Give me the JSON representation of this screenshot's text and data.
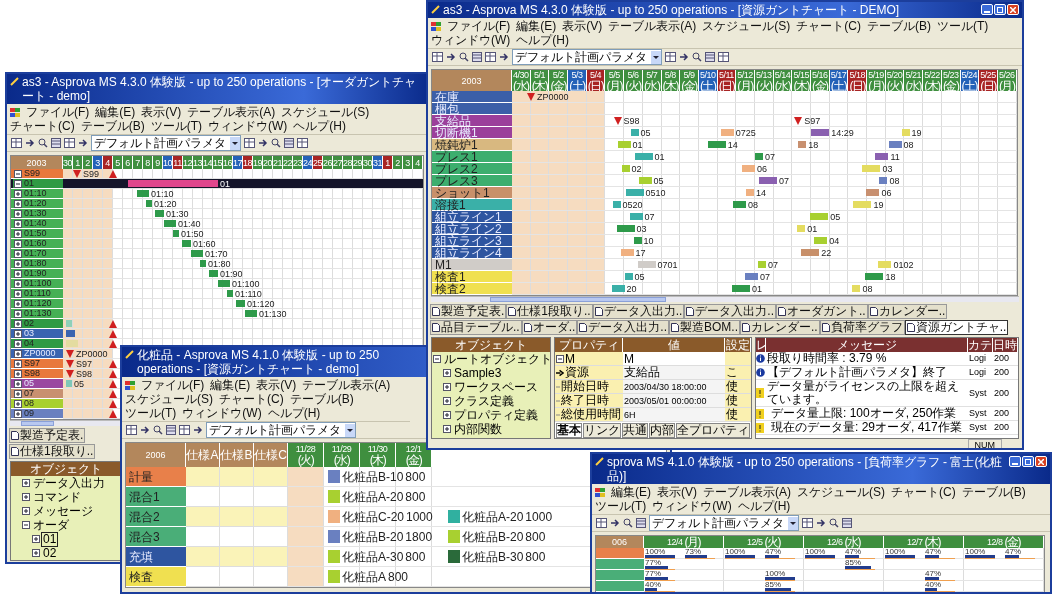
{
  "windows": [
    {
      "kind": "order_gantt",
      "title": "as3 - Asprova MS 4.3.0 体験版 - up to 250 operations - [オーダガントチャート - demo]",
      "menu": [
        "ファイル(F)",
        "編集(E)",
        "表示(V)",
        "テーブル表示(A)",
        "スケジュール(S)",
        "チャート(C)",
        "テーブル(B)",
        "ツール(T)",
        "ウィンドウ(W)",
        "ヘルプ(H)"
      ],
      "combo": "デフォルト計画パラメタ",
      "year": "2003",
      "dates": [
        {
          "date": "30",
          "kind": "weekday",
          "past": true
        },
        {
          "date": "1",
          "kind": "weekday",
          "past": true
        },
        {
          "date": "2",
          "kind": "weekday",
          "past": true
        },
        {
          "date": "3",
          "kind": "saturday",
          "past": true
        },
        {
          "date": "4",
          "kind": "sunday",
          "past": true
        },
        {
          "date": "5",
          "kind": "weekday",
          "past": false
        },
        {
          "date": "6",
          "kind": "weekday",
          "past": false
        },
        {
          "date": "7",
          "kind": "weekday",
          "past": false
        },
        {
          "date": "8",
          "kind": "weekday",
          "past": false
        },
        {
          "date": "9",
          "kind": "weekday",
          "past": false
        },
        {
          "date": "10",
          "kind": "saturday",
          "past": false
        },
        {
          "date": "11",
          "kind": "sunday",
          "past": false
        },
        {
          "date": "12",
          "kind": "weekday",
          "past": false
        },
        {
          "date": "13",
          "kind": "weekday",
          "past": false
        },
        {
          "date": "14",
          "kind": "weekday",
          "past": false
        },
        {
          "date": "15",
          "kind": "weekday",
          "past": false
        },
        {
          "date": "16",
          "kind": "weekday",
          "past": false
        },
        {
          "date": "17",
          "kind": "saturday",
          "past": false
        },
        {
          "date": "18",
          "kind": "sunday",
          "past": false
        },
        {
          "date": "19",
          "kind": "weekday",
          "past": false
        },
        {
          "date": "20",
          "kind": "weekday",
          "past": false
        },
        {
          "date": "21",
          "kind": "weekday",
          "past": false
        },
        {
          "date": "22",
          "kind": "weekday",
          "past": false
        },
        {
          "date": "23",
          "kind": "weekday",
          "past": false
        },
        {
          "date": "24",
          "kind": "saturday",
          "past": false
        },
        {
          "date": "25",
          "kind": "sunday",
          "past": false
        },
        {
          "date": "26",
          "kind": "weekday",
          "past": false
        },
        {
          "date": "27",
          "kind": "weekday",
          "past": false
        },
        {
          "date": "28",
          "kind": "weekday",
          "past": false
        },
        {
          "date": "29",
          "kind": "weekday",
          "past": false
        },
        {
          "date": "30",
          "kind": "weekday",
          "past": false
        },
        {
          "date": "31",
          "kind": "saturday",
          "past": false
        },
        {
          "date": "1",
          "kind": "sunday",
          "past": false
        },
        {
          "date": "2",
          "kind": "weekday",
          "past": false
        },
        {
          "date": "3",
          "kind": "weekday",
          "past": false
        },
        {
          "date": "4",
          "kind": "weekday",
          "past": false
        }
      ],
      "rows": [
        {
          "label": "S99",
          "color": "#e8783c",
          "expanded": true,
          "selected": false,
          "bars": [
            {
              "kind": "marker",
              "label": "S99"
            },
            {
              "kind": "due"
            }
          ]
        },
        {
          "label": "01",
          "color": "#2f9a44",
          "expanded": true,
          "selected": true,
          "bars": [
            {
              "kind": "bar",
              "label": "01",
              "color": "#e0468c"
            }
          ]
        },
        {
          "label": "01:10",
          "color": "#45b055",
          "expanded": false,
          "selected": false,
          "bars": [
            {
              "kind": "bar",
              "label": "01:10",
              "color": "#2e9a4a"
            }
          ]
        },
        {
          "label": "01:20",
          "color": "#45b055",
          "expanded": false,
          "selected": false,
          "bars": [
            {
              "kind": "bar",
              "label": "01:20",
              "color": "#2e9a4a"
            }
          ]
        },
        {
          "label": "01:30",
          "color": "#45b055",
          "expanded": false,
          "selected": false,
          "bars": [
            {
              "kind": "bar",
              "label": "01:30",
              "color": "#2e9a4a"
            }
          ]
        },
        {
          "label": "01:40",
          "color": "#45b055",
          "expanded": false,
          "selected": false,
          "bars": [
            {
              "kind": "bar",
              "label": "01:40",
              "color": "#2e9a4a"
            }
          ]
        },
        {
          "label": "01:50",
          "color": "#45b055",
          "expanded": false,
          "selected": false,
          "bars": [
            {
              "kind": "bar",
              "label": "01:50",
              "color": "#2e9a4a"
            }
          ]
        },
        {
          "label": "01:60",
          "color": "#45b055",
          "expanded": false,
          "selected": false,
          "bars": [
            {
              "kind": "bar",
              "label": "01:60",
              "color": "#2e9a4a"
            }
          ]
        },
        {
          "label": "01:70",
          "color": "#45b055",
          "expanded": false,
          "selected": false,
          "bars": [
            {
              "kind": "bar",
              "label": "01:70",
              "color": "#2e9a4a"
            }
          ]
        },
        {
          "label": "01:80",
          "color": "#45b055",
          "expanded": false,
          "selected": false,
          "bars": [
            {
              "kind": "bar",
              "label": "01:80",
              "color": "#2e9a4a"
            }
          ]
        },
        {
          "label": "01:90",
          "color": "#45b055",
          "expanded": false,
          "selected": false,
          "bars": [
            {
              "kind": "bar",
              "label": "01:90",
              "color": "#2e9a4a"
            }
          ]
        },
        {
          "label": "01:100",
          "color": "#45b055",
          "expanded": false,
          "selected": false,
          "bars": [
            {
              "kind": "bar",
              "label": "01:100",
              "color": "#2e9a4a"
            }
          ]
        },
        {
          "label": "01:110",
          "color": "#45b055",
          "expanded": false,
          "selected": false,
          "bars": [
            {
              "kind": "bar",
              "label": "01:110",
              "color": "#2e9a4a"
            }
          ]
        },
        {
          "label": "01:120",
          "color": "#45b055",
          "expanded": false,
          "selected": false,
          "bars": [
            {
              "kind": "bar",
              "label": "01:120",
              "color": "#2e9a4a"
            }
          ]
        },
        {
          "label": "01:130",
          "color": "#45b055",
          "expanded": false,
          "selected": false,
          "bars": [
            {
              "kind": "bar",
              "label": "01:130",
              "color": "#2e9a4a"
            }
          ]
        },
        {
          "label": "02",
          "color": "#2f9a44",
          "expanded": false,
          "selected": false,
          "bars": [
            {
              "kind": "due"
            },
            {
              "kind": "bar",
              "color": "#8fd0b8"
            }
          ]
        },
        {
          "label": "03",
          "color": "#3a64b0",
          "expanded": false,
          "selected": false,
          "bars": [
            {
              "kind": "due"
            },
            {
              "kind": "bar",
              "color": "#3a64b0"
            }
          ]
        },
        {
          "label": "04",
          "color": "#2f9a44",
          "expanded": false,
          "selected": false,
          "bars": [
            {
              "kind": "due"
            },
            {
              "kind": "bar",
              "color": "#e4dca0"
            }
          ]
        },
        {
          "label": "ZP0000",
          "color": "#3a64b0",
          "expanded": false,
          "selected": false,
          "bars": [
            {
              "kind": "marker",
              "label": "ZP0000"
            }
          ]
        },
        {
          "label": "S97",
          "color": "#e8783c",
          "expanded": false,
          "selected": false,
          "bars": [
            {
              "kind": "due"
            },
            {
              "kind": "marker",
              "label": "S97"
            }
          ]
        },
        {
          "label": "S98",
          "color": "#e8783c",
          "expanded": false,
          "selected": false,
          "bars": [
            {
              "kind": "due"
            },
            {
              "kind": "marker",
              "label": "S98"
            }
          ]
        },
        {
          "label": "05",
          "color": "#9a48a0",
          "expanded": false,
          "selected": false,
          "bars": [
            {
              "kind": "due"
            },
            {
              "kind": "bar",
              "label": "05",
              "color": "#7fc8b8"
            }
          ]
        },
        {
          "label": "07",
          "color": "#c89070",
          "expanded": false,
          "selected": false,
          "bars": [
            {
              "kind": "due"
            }
          ]
        },
        {
          "label": "08",
          "color": "#a8d030",
          "expanded": false,
          "selected": false,
          "bars": [
            {
              "kind": "due"
            }
          ]
        },
        {
          "label": "09",
          "color": "#6a80c0",
          "expanded": false,
          "selected": false,
          "bars": [
            {
              "kind": "due"
            }
          ]
        }
      ],
      "tabs": [
        {
          "label": "製造予定表.",
          "selected": false
        },
        {
          "label": "仕様1段取り..",
          "selected": false
        }
      ],
      "tree": {
        "title": "オブジェクト",
        "items": [
          {
            "label": "データ入出力",
            "expanded": false,
            "selected": false
          },
          {
            "label": "コマンド",
            "expanded": false,
            "selected": false
          },
          {
            "label": "メッセージ",
            "expanded": false,
            "selected": false
          },
          {
            "label": "オーダ",
            "expanded": true,
            "selected": false,
            "children": [
              {
                "label": "01",
                "expanded": false,
                "selected": true
              },
              {
                "label": "02",
                "expanded": false,
                "selected": false
              }
            ]
          }
        ]
      }
    },
    {
      "kind": "resource_gantt",
      "title": "化粧品 - Asprova MS 4.1.0 体験版 - up to 250 operations - [資源ガントチャート - demo]",
      "menu": [
        "ファイル(F)",
        "編集(E)",
        "表示(V)",
        "テーブル表示(A)",
        "スケジュール(S)",
        "チャート(C)",
        "テーブル(B)",
        "ツール(T)",
        "ウィンドウ(W)",
        "ヘルプ(H)"
      ],
      "combo": "デフォルト計画パラメタ",
      "year": "2006",
      "specs": [
        "仕様A",
        "仕様B",
        "仕様C"
      ],
      "dates": [
        {
          "date": "11/28",
          "weekday": "(火)",
          "kind": "weekday",
          "past": true
        },
        {
          "date": "11/29",
          "weekday": "(水)",
          "kind": "weekday",
          "past": false
        },
        {
          "date": "11/30",
          "weekday": "(木)",
          "kind": "weekday",
          "past": false
        },
        {
          "date": "12/1",
          "weekday": "(金)",
          "kind": "weekday",
          "past": false
        }
      ],
      "rows": [
        {
          "label": "計量",
          "color": "#e8804a",
          "bars": [
            {
              "kind": "bar",
              "label": "化粧品B-10",
              "qty": "800",
              "color": "#6a80c0"
            }
          ]
        },
        {
          "label": "混合1",
          "color": "#4aae78",
          "bars": [
            {
              "kind": "bar",
              "label": "化粧品A-20",
              "qty": "800",
              "color": "#a8d030"
            }
          ]
        },
        {
          "label": "混合2",
          "color": "#4aae78",
          "bars": [
            {
              "kind": "bar",
              "label": "化粧品C-20",
              "qty": "1000",
              "color": "#f0b080"
            },
            {
              "kind": "bar",
              "label": "化粧品A-20",
              "qty": "1000",
              "color": "#30b0a0"
            }
          ]
        },
        {
          "label": "混合3",
          "color": "#4aae78",
          "bars": [
            {
              "kind": "bar",
              "label": "化粧品B-20",
              "qty": "1800",
              "color": "#6a80c0"
            },
            {
              "kind": "bar",
              "label": "化粧品B-20",
              "qty": "800",
              "color": "#a8d030"
            }
          ]
        },
        {
          "label": "充填",
          "color": "#2e55a0",
          "bars": [
            {
              "kind": "bar",
              "label": "化粧品A-30",
              "qty": "800",
              "color": "#a8d030"
            },
            {
              "kind": "bar",
              "label": "化粧品B-30",
              "qty": "800",
              "color": "#2a6a3a"
            }
          ]
        },
        {
          "label": "検査",
          "color": "#f0e050",
          "bars": [
            {
              "kind": "bar",
              "label": "化粧品A",
              "qty": "800",
              "color": "#a8d030"
            }
          ]
        }
      ]
    },
    {
      "kind": "resource_gantt",
      "title": "as3 - Asprova MS 4.3.0 体験版 - up to 250 operations - [資源ガントチャート - DEMO]",
      "controls": true,
      "menu": [
        "ファイル(F)",
        "編集(E)",
        "表示(V)",
        "テーブル表示(A)",
        "スケジュール(S)",
        "チャート(C)",
        "テーブル(B)",
        "ツール(T)",
        "ウィンドウ(W)",
        "ヘルプ(H)"
      ],
      "combo": "デフォルト計画パラメタ",
      "year": "2003",
      "dates": [
        {
          "date": "4/30",
          "weekday": "(水)",
          "kind": "weekday",
          "past": true
        },
        {
          "date": "5/1",
          "weekday": "(木)",
          "kind": "weekday",
          "past": true
        },
        {
          "date": "5/2",
          "weekday": "(金)",
          "kind": "weekday",
          "past": true
        },
        {
          "date": "5/3",
          "weekday": "(土)",
          "kind": "saturday",
          "past": true
        },
        {
          "date": "5/4",
          "weekday": "(日)",
          "kind": "sunday",
          "past": true
        },
        {
          "date": "5/5",
          "weekday": "(月)",
          "kind": "weekday",
          "past": false
        },
        {
          "date": "5/6",
          "weekday": "(火)",
          "kind": "weekday",
          "past": false
        },
        {
          "date": "5/7",
          "weekday": "(水)",
          "kind": "weekday",
          "past": false
        },
        {
          "date": "5/8",
          "weekday": "(木)",
          "kind": "weekday",
          "past": false
        },
        {
          "date": "5/9",
          "weekday": "(金)",
          "kind": "weekday",
          "past": false
        },
        {
          "date": "5/10",
          "weekday": "(土)",
          "kind": "saturday",
          "past": false
        },
        {
          "date": "5/11",
          "weekday": "(日)",
          "kind": "sunday",
          "past": false
        },
        {
          "date": "5/12",
          "weekday": "(月)",
          "kind": "weekday",
          "past": false
        },
        {
          "date": "5/13",
          "weekday": "(火)",
          "kind": "weekday",
          "past": false
        },
        {
          "date": "5/14",
          "weekday": "(水)",
          "kind": "weekday",
          "past": false
        },
        {
          "date": "5/15",
          "weekday": "(木)",
          "kind": "weekday",
          "past": false
        },
        {
          "date": "5/16",
          "weekday": "(金)",
          "kind": "weekday",
          "past": false
        },
        {
          "date": "5/17",
          "weekday": "(土)",
          "kind": "saturday",
          "past": false
        },
        {
          "date": "5/18",
          "weekday": "(日)",
          "kind": "sunday",
          "past": false
        },
        {
          "date": "5/19",
          "weekday": "(月)",
          "kind": "weekday",
          "past": false
        },
        {
          "date": "5/20",
          "weekday": "(火)",
          "kind": "weekday",
          "past": false
        },
        {
          "date": "5/21",
          "weekday": "(水)",
          "kind": "weekday",
          "past": false
        },
        {
          "date": "5/22",
          "weekday": "(木)",
          "kind": "weekday",
          "past": false
        },
        {
          "date": "5/23",
          "weekday": "(金)",
          "kind": "weekday",
          "past": false
        },
        {
          "date": "5/24",
          "weekday": "(土)",
          "kind": "saturday",
          "past": false
        },
        {
          "date": "5/25",
          "weekday": "(日)",
          "kind": "sunday",
          "past": false
        },
        {
          "date": "5/26",
          "weekday": "(月)",
          "kind": "weekday",
          "past": false
        }
      ],
      "rows": [
        {
          "label": "在庫",
          "color": "#3b5fa8",
          "bars": [
            {
              "kind": "marker",
              "label": "ZP0000"
            }
          ]
        },
        {
          "label": "梱包",
          "color": "#3b5fa8",
          "bars": []
        },
        {
          "label": "支給品",
          "color": "#9b3f9b",
          "bars": [
            {
              "kind": "marker",
              "label": "S98"
            },
            {
              "kind": "marker",
              "label": "S97"
            }
          ]
        },
        {
          "label": "切断機1",
          "color": "#9b3f9b",
          "bars": [
            {
              "kind": "bar",
              "label": "05",
              "color": "#3ab0a8"
            },
            {
              "kind": "bar",
              "label": "0725",
              "color": "#f0b080"
            },
            {
              "kind": "bar",
              "label": "14:29",
              "color": "#8a60b0"
            },
            {
              "kind": "bar",
              "label": "19",
              "color": "#e4dc60"
            }
          ]
        },
        {
          "label": "焼鈍炉1",
          "color": "#d8b880",
          "bars": [
            {
              "kind": "bar",
              "label": "01",
              "color": "#a8d030"
            },
            {
              "kind": "bar",
              "label": "14",
              "color": "#2e9a4a"
            },
            {
              "kind": "bar",
              "label": "18",
              "color": "#c89070"
            },
            {
              "kind": "bar",
              "label": "08",
              "color": "#6a80c0"
            }
          ]
        },
        {
          "label": "プレス1",
          "color": "#3cae6e",
          "bars": [
            {
              "kind": "bar",
              "label": "01",
              "color": "#3ab0a8"
            },
            {
              "kind": "bar",
              "label": "07",
              "color": "#2e9a4a"
            },
            {
              "kind": "bar",
              "label": "11",
              "color": "#8a60b0"
            }
          ]
        },
        {
          "label": "プレス2",
          "color": "#3cae6e",
          "bars": [
            {
              "kind": "bar",
              "label": "02",
              "color": "#a8d030"
            },
            {
              "kind": "bar",
              "label": "06",
              "color": "#f0b080"
            },
            {
              "kind": "bar",
              "label": "03",
              "color": "#e4dc60"
            }
          ]
        },
        {
          "label": "プレス3",
          "color": "#3cae6e",
          "bars": [
            {
              "kind": "bar",
              "label": "05",
              "color": "#a8d030"
            },
            {
              "kind": "bar",
              "label": "07",
              "color": "#8a60b0"
            },
            {
              "kind": "bar",
              "label": "08",
              "color": "#6a80c0"
            }
          ]
        },
        {
          "label": "ショット1",
          "color": "#c8906a",
          "bars": [
            {
              "kind": "bar",
              "label": "0510",
              "color": "#3ab0a8"
            },
            {
              "kind": "bar",
              "label": "14",
              "color": "#f0b080"
            },
            {
              "kind": "bar",
              "label": "06",
              "color": "#c89070"
            }
          ]
        },
        {
          "label": "溶接1",
          "color": "#3ab0a8",
          "bars": [
            {
              "kind": "bar",
              "label": "0520",
              "color": "#3ab0a8"
            },
            {
              "kind": "bar",
              "label": "08",
              "color": "#2e9a4a"
            },
            {
              "kind": "bar",
              "label": "19",
              "color": "#e4dc60"
            }
          ]
        },
        {
          "label": "組立ライン1",
          "color": "#2e55a0",
          "bars": [
            {
              "kind": "bar",
              "label": "07",
              "color": "#3ab0a8"
            },
            {
              "kind": "bar",
              "label": "05",
              "color": "#a8d030"
            }
          ]
        },
        {
          "label": "組立ライン2",
          "color": "#2e55a0",
          "bars": [
            {
              "kind": "bar",
              "label": "03",
              "color": "#2e9a4a"
            },
            {
              "kind": "bar",
              "label": "01",
              "color": "#e4dc60"
            }
          ]
        },
        {
          "label": "組立ライン3",
          "color": "#2e55a0",
          "bars": [
            {
              "kind": "bar",
              "label": "10",
              "color": "#2e9a4a"
            },
            {
              "kind": "bar",
              "label": "04",
              "color": "#a8d030"
            }
          ]
        },
        {
          "label": "組立ライン4",
          "color": "#2e55a0",
          "bars": [
            {
              "kind": "bar",
              "label": "17",
              "color": "#f0b080"
            },
            {
              "kind": "bar",
              "label": "22",
              "color": "#c8906a"
            }
          ]
        },
        {
          "label": "M1",
          "color": "#d0ccc8",
          "bars": [
            {
              "kind": "bar",
              "label": "0701",
              "color": "#d0ccc8"
            },
            {
              "kind": "bar",
              "label": "07",
              "color": "#a8d030"
            },
            {
              "kind": "bar",
              "label": "0102",
              "color": "#e4dc60"
            }
          ]
        },
        {
          "label": "検査1",
          "color": "#f0e050",
          "bars": [
            {
              "kind": "bar",
              "label": "05",
              "color": "#3ab0a8"
            },
            {
              "kind": "bar",
              "label": "07",
              "color": "#6a80c0"
            },
            {
              "kind": "bar",
              "label": "18",
              "color": "#2e9a4a"
            }
          ]
        },
        {
          "label": "検査2",
          "color": "#f0e050",
          "bars": [
            {
              "kind": "bar",
              "label": "20",
              "color": "#3ab0a8"
            },
            {
              "kind": "bar",
              "label": "01",
              "color": "#2e9a4a"
            },
            {
              "kind": "bar",
              "label": "08",
              "color": "#e4dc60"
            }
          ]
        }
      ],
      "tabs": [
        {
          "label": "製造予定表.",
          "selected": false
        },
        {
          "label": "仕様1段取り..",
          "selected": false
        },
        {
          "label": "データ入出力..",
          "selected": false
        },
        {
          "label": "データ入出力..",
          "selected": false
        },
        {
          "label": "オーダガント..",
          "selected": false
        },
        {
          "label": "カレンダー..",
          "selected": false
        },
        {
          "label": "品目テーブル..",
          "selected": false
        },
        {
          "label": "オーダ..",
          "selected": false
        },
        {
          "label": "データ入出力..",
          "selected": false
        },
        {
          "label": "製造BOM..",
          "selected": false
        },
        {
          "label": "カレンダー..",
          "selected": false
        },
        {
          "label": "負荷率グラフ",
          "selected": false
        },
        {
          "label": "資源ガントチャ..",
          "selected": true
        }
      ],
      "tree": {
        "title": "オブジェクト",
        "items": [
          {
            "label": "ルートオブジェクト",
            "expanded": true,
            "selected": false,
            "children": [
              {
                "label": "Sample3",
                "expanded": false,
                "selected": false
              },
              {
                "label": "ワークスペース",
                "expanded": false,
                "selected": false
              },
              {
                "label": "クラス定義",
                "expanded": false,
                "selected": false
              },
              {
                "label": "プロパティ定義",
                "expanded": false,
                "selected": false
              },
              {
                "label": "内部関数",
                "expanded": false,
                "selected": false
              }
            ]
          }
        ]
      },
      "properties": {
        "columns": [
          "プロパティ",
          "値",
          "設定"
        ],
        "rows": [
          {
            "kind": "group",
            "name": "M",
            "value": "M"
          },
          {
            "kind": "link",
            "name": "資源",
            "value": "支給品",
            "flag": "こ"
          },
          {
            "kind": "field",
            "name": "開始日時",
            "value": "2003/04/30 18:00:00",
            "flag": "使"
          },
          {
            "kind": "field",
            "name": "終了日時",
            "value": "2003/05/01 00:00:00",
            "flag": "使"
          },
          {
            "kind": "field",
            "name": "総使用時間",
            "value": "6H",
            "flag": "使"
          }
        ],
        "tabs": [
          {
            "label": "基本",
            "selected": true
          },
          {
            "label": "リンク",
            "selected": false
          },
          {
            "label": "共通",
            "selected": false
          },
          {
            "label": "内部",
            "selected": false
          },
          {
            "label": "全プロパティ",
            "selected": false
          }
        ]
      },
      "messages": {
        "columns": [
          "レ",
          "メッセージ",
          "カテ",
          "日時"
        ],
        "rows": [
          {
            "kind": "info",
            "text": "段取り時間率 : 3.79 %",
            "category": "Logi",
            "time": "200"
          },
          {
            "kind": "info",
            "text": "【デフォルト計画パラメタ】終了",
            "category": "Logi",
            "time": "200"
          },
          {
            "kind": "warning",
            "text": "データ量がライセンスの上限を超えています。",
            "category": "Syst",
            "time": "200",
            "children": [
              {
                "kind": "warning",
                "text": "データ量上限: 100オーダ, 250作業",
                "category": "Syst",
                "time": "200"
              },
              {
                "kind": "warning",
                "text": "現在のデータ量: 29オーダ, 417作業",
                "category": "Syst",
                "time": "200"
              }
            ]
          }
        ]
      },
      "status": "NUM"
    },
    {
      "kind": "load_graph",
      "title": "sprova MS 4.1.0 体験版 - up to 250 operations - [負荷率グラフ - 富士(化粧品)]",
      "controls": true,
      "menu": [
        "編集(E)",
        "表示(V)",
        "テーブル表示(A)",
        "スケジュール(S)",
        "チャート(C)",
        "テーブル(B)",
        "ツール(T)",
        "ウィンドウ(W)",
        "ヘルプ(H)"
      ],
      "combo": "デフォルト計画パラメタ",
      "year": "006",
      "dates": [
        {
          "date": "12/4",
          "weekday": "(月)",
          "kind": "weekday",
          "past": false
        },
        {
          "date": "12/5",
          "weekday": "(火)",
          "kind": "weekday",
          "past": false
        },
        {
          "date": "12/6",
          "weekday": "(水)",
          "kind": "weekday",
          "past": false
        },
        {
          "date": "12/7",
          "weekday": "(木)",
          "kind": "weekday",
          "past": false
        },
        {
          "date": "12/8",
          "weekday": "(金)",
          "kind": "weekday",
          "past": false
        }
      ],
      "rows": [
        {
          "color": "#e8804a",
          "loads": [
            {
              "text": "100%",
              "level": 1
            },
            {
              "text": "73%",
              "level": 0.73
            },
            {
              "text": "100%",
              "level": 1
            },
            {
              "text": "47%",
              "level": 0.47
            },
            {
              "text": "100%",
              "level": 1
            },
            {
              "text": "47%",
              "level": 0.47
            },
            {
              "text": "100%",
              "level": 1
            },
            {
              "text": "47%",
              "level": 0.47
            },
            {
              "text": "100%",
              "level": 1
            },
            {
              "text": "47%",
              "level": 0.47
            }
          ]
        },
        {
          "color": "#4aae78",
          "loads": [
            {
              "text": "77%",
              "level": 0.77
            },
            {
              "text": "85%",
              "level": 0.85
            }
          ]
        },
        {
          "color": "#4aae78",
          "loads": [
            {
              "text": "77%",
              "level": 0.77
            },
            {
              "text": "100%",
              "level": 1
            },
            {
              "text": "47%",
              "level": 0.47
            }
          ]
        },
        {
          "color": "#4aae78",
          "loads": [
            {
              "text": "40%",
              "level": 0.4
            },
            {
              "text": "85%",
              "level": 0.85
            },
            {
              "text": "40%",
              "level": 0.4
            }
          ]
        }
      ]
    }
  ]
}
